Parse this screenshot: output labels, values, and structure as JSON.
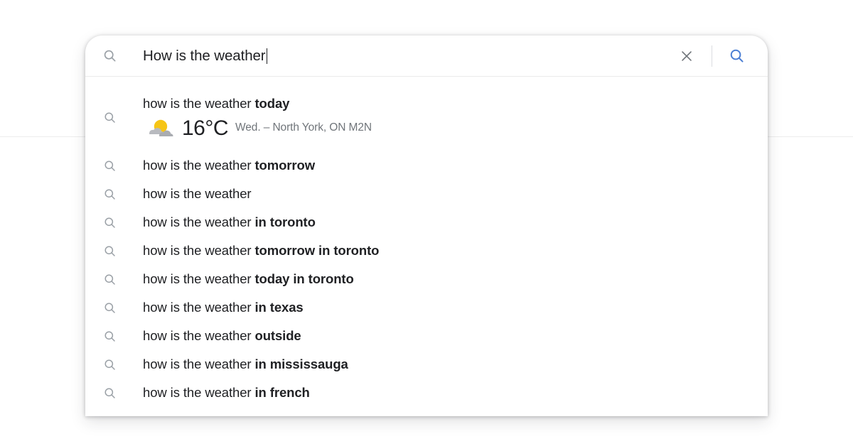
{
  "colors": {
    "accent_blue": "#4c7fd4",
    "text_primary": "#202124",
    "text_secondary": "#70757a",
    "icon_gray": "#9aa0a6",
    "divider": "#ebebeb",
    "sun_yellow": "#f6c516",
    "cloud_gray": "#b0b3b8",
    "card_background": "#ffffff",
    "page_background": "#ffffff"
  },
  "search": {
    "lead_icon": "search-icon",
    "value": "How is the weather",
    "placeholder": "Search",
    "clear_icon": "close-icon",
    "clear_label": "Clear",
    "submit_icon": "search-icon",
    "submit_label": "Search"
  },
  "suggestions": [
    {
      "icon": "search-icon",
      "type": "rich-weather",
      "prefix": "how is the weather ",
      "bold": "today",
      "weather": {
        "icon": "partly-cloudy-icon",
        "temperature": "16°C",
        "meta": "Wed. – North York, ON M2N"
      }
    },
    {
      "icon": "search-icon",
      "type": "plain",
      "prefix": "how is the weather ",
      "bold": "tomorrow"
    },
    {
      "icon": "search-icon",
      "type": "plain",
      "prefix": "how is the weather",
      "bold": ""
    },
    {
      "icon": "search-icon",
      "type": "plain",
      "prefix": "how is the weather ",
      "bold": "in toronto"
    },
    {
      "icon": "search-icon",
      "type": "plain",
      "prefix": "how is the weather ",
      "bold": "tomorrow in toronto"
    },
    {
      "icon": "search-icon",
      "type": "plain",
      "prefix": "how is the weather ",
      "bold": "today in toronto"
    },
    {
      "icon": "search-icon",
      "type": "plain",
      "prefix": "how is the weather ",
      "bold": "in texas"
    },
    {
      "icon": "search-icon",
      "type": "plain",
      "prefix": "how is the weather ",
      "bold": "outside"
    },
    {
      "icon": "search-icon",
      "type": "plain",
      "prefix": "how is the weather ",
      "bold": "in mississauga"
    },
    {
      "icon": "search-icon",
      "type": "plain",
      "prefix": "how is the weather ",
      "bold": "in french"
    }
  ]
}
